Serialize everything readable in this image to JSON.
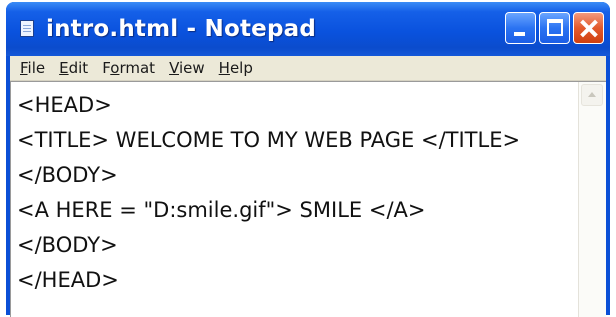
{
  "window": {
    "title": "intro.html - Notepad",
    "icon": "notepad-icon",
    "accent_color": "#0a4fd6",
    "close_color": "#e35a2c"
  },
  "menu": {
    "items": [
      {
        "label_u": "F",
        "label_rest": "ile"
      },
      {
        "label_u": "E",
        "label_rest": "dit"
      },
      {
        "label_pre": "F",
        "label_u": "o",
        "label_rest": "rmat"
      },
      {
        "label_u": "V",
        "label_rest": "iew"
      },
      {
        "label_u": "H",
        "label_rest": "elp"
      }
    ]
  },
  "editor": {
    "lines": [
      "<HEAD>",
      "<TITLE> WELCOME TO MY WEB PAGE </TITLE>",
      "</BODY>",
      "<A HERE = \"D:smile.gif\"> SMILE </A>",
      "</BODY>",
      "</HEAD>"
    ]
  }
}
